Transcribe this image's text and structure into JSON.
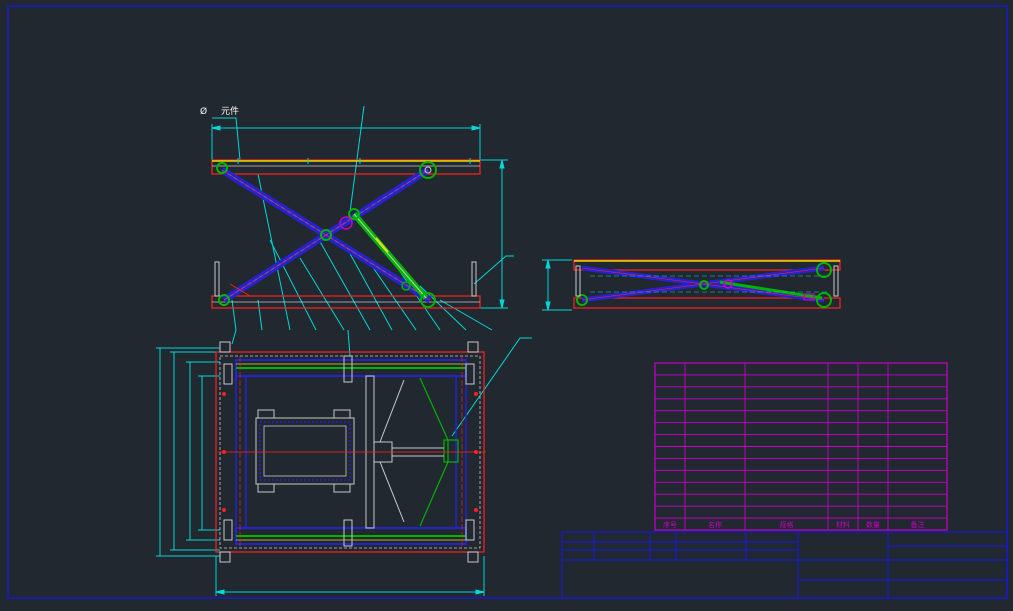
{
  "annotation": {
    "dia_symbol": "Ø",
    "note": "元件"
  },
  "bom_headers": [
    "序号",
    "名称",
    "规格",
    "材料",
    "数量",
    "备注"
  ],
  "colors": {
    "background": "#212830",
    "frame": "#1a1ac8",
    "dimension": "#00d8d8",
    "outline": "#c8c8c8",
    "member": "#2323d0",
    "centerline": "#ff2020",
    "hydraulic": "#00b400",
    "top_plate": "#e0e000",
    "pin": "#c800c8",
    "table": "#c800c8"
  }
}
